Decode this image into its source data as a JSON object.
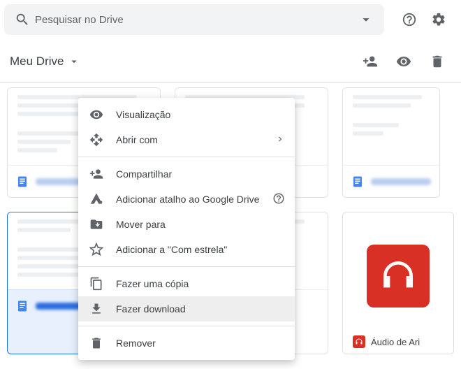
{
  "search": {
    "placeholder": "Pesquisar no Drive"
  },
  "breadcrumb": {
    "label": "Meu Drive"
  },
  "audio": {
    "title": "Áudio de Ari"
  },
  "menu": {
    "preview": "Visualização",
    "open_with": "Abrir com",
    "share": "Compartilhar",
    "shortcut": "Adicionar atalho ao Google Drive",
    "move": "Mover para",
    "star": "Adicionar a \"Com estrela\"",
    "copy": "Fazer uma cópia",
    "download": "Fazer download",
    "remove": "Remover"
  }
}
